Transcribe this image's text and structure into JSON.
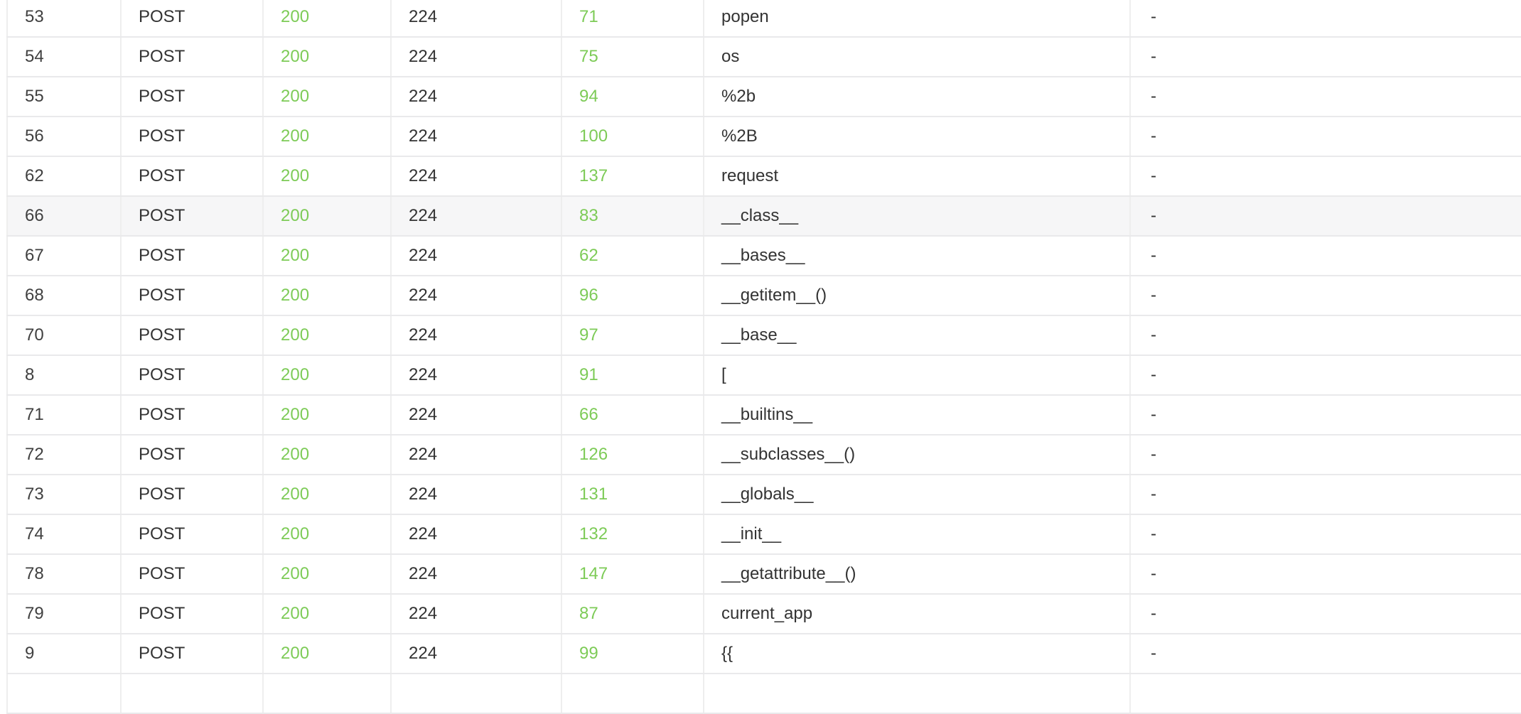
{
  "table": {
    "rows": [
      {
        "id": "53",
        "method": "POST",
        "status": "200",
        "length": "224",
        "time": "71",
        "payload": "popen",
        "extra": "-"
      },
      {
        "id": "54",
        "method": "POST",
        "status": "200",
        "length": "224",
        "time": "75",
        "payload": "os",
        "extra": "-"
      },
      {
        "id": "55",
        "method": "POST",
        "status": "200",
        "length": "224",
        "time": "94",
        "payload": "%2b",
        "extra": "-"
      },
      {
        "id": "56",
        "method": "POST",
        "status": "200",
        "length": "224",
        "time": "100",
        "payload": "%2B",
        "extra": "-"
      },
      {
        "id": "62",
        "method": "POST",
        "status": "200",
        "length": "224",
        "time": "137",
        "payload": "request",
        "extra": "-"
      },
      {
        "id": "66",
        "method": "POST",
        "status": "200",
        "length": "224",
        "time": "83",
        "payload": "__class__",
        "extra": "-"
      },
      {
        "id": "67",
        "method": "POST",
        "status": "200",
        "length": "224",
        "time": "62",
        "payload": "__bases__",
        "extra": "-"
      },
      {
        "id": "68",
        "method": "POST",
        "status": "200",
        "length": "224",
        "time": "96",
        "payload": "__getitem__()",
        "extra": "-"
      },
      {
        "id": "70",
        "method": "POST",
        "status": "200",
        "length": "224",
        "time": "97",
        "payload": "__base__",
        "extra": "-"
      },
      {
        "id": "8",
        "method": "POST",
        "status": "200",
        "length": "224",
        "time": "91",
        "payload": "[",
        "extra": "-"
      },
      {
        "id": "71",
        "method": "POST",
        "status": "200",
        "length": "224",
        "time": "66",
        "payload": "__builtins__",
        "extra": "-"
      },
      {
        "id": "72",
        "method": "POST",
        "status": "200",
        "length": "224",
        "time": "126",
        "payload": "__subclasses__()",
        "extra": "-"
      },
      {
        "id": "73",
        "method": "POST",
        "status": "200",
        "length": "224",
        "time": "131",
        "payload": "__globals__",
        "extra": "-"
      },
      {
        "id": "74",
        "method": "POST",
        "status": "200",
        "length": "224",
        "time": "132",
        "payload": "__init__",
        "extra": "-"
      },
      {
        "id": "78",
        "method": "POST",
        "status": "200",
        "length": "224",
        "time": "147",
        "payload": "__getattribute__()",
        "extra": "-"
      },
      {
        "id": "79",
        "method": "POST",
        "status": "200",
        "length": "224",
        "time": "87",
        "payload": "current_app",
        "extra": "-"
      },
      {
        "id": "9",
        "method": "POST",
        "status": "200",
        "length": "224",
        "time": "99",
        "payload": "{{",
        "extra": "-"
      },
      {
        "id": "",
        "method": "",
        "status": "",
        "length": "",
        "time": "",
        "payload": "",
        "extra": ""
      }
    ],
    "highlighted_row_index": 5
  },
  "colors": {
    "accent_green": "#67c23a",
    "text": "#333333",
    "border": "#e9e9eb",
    "highlight_bg": "#f6f6f7"
  }
}
